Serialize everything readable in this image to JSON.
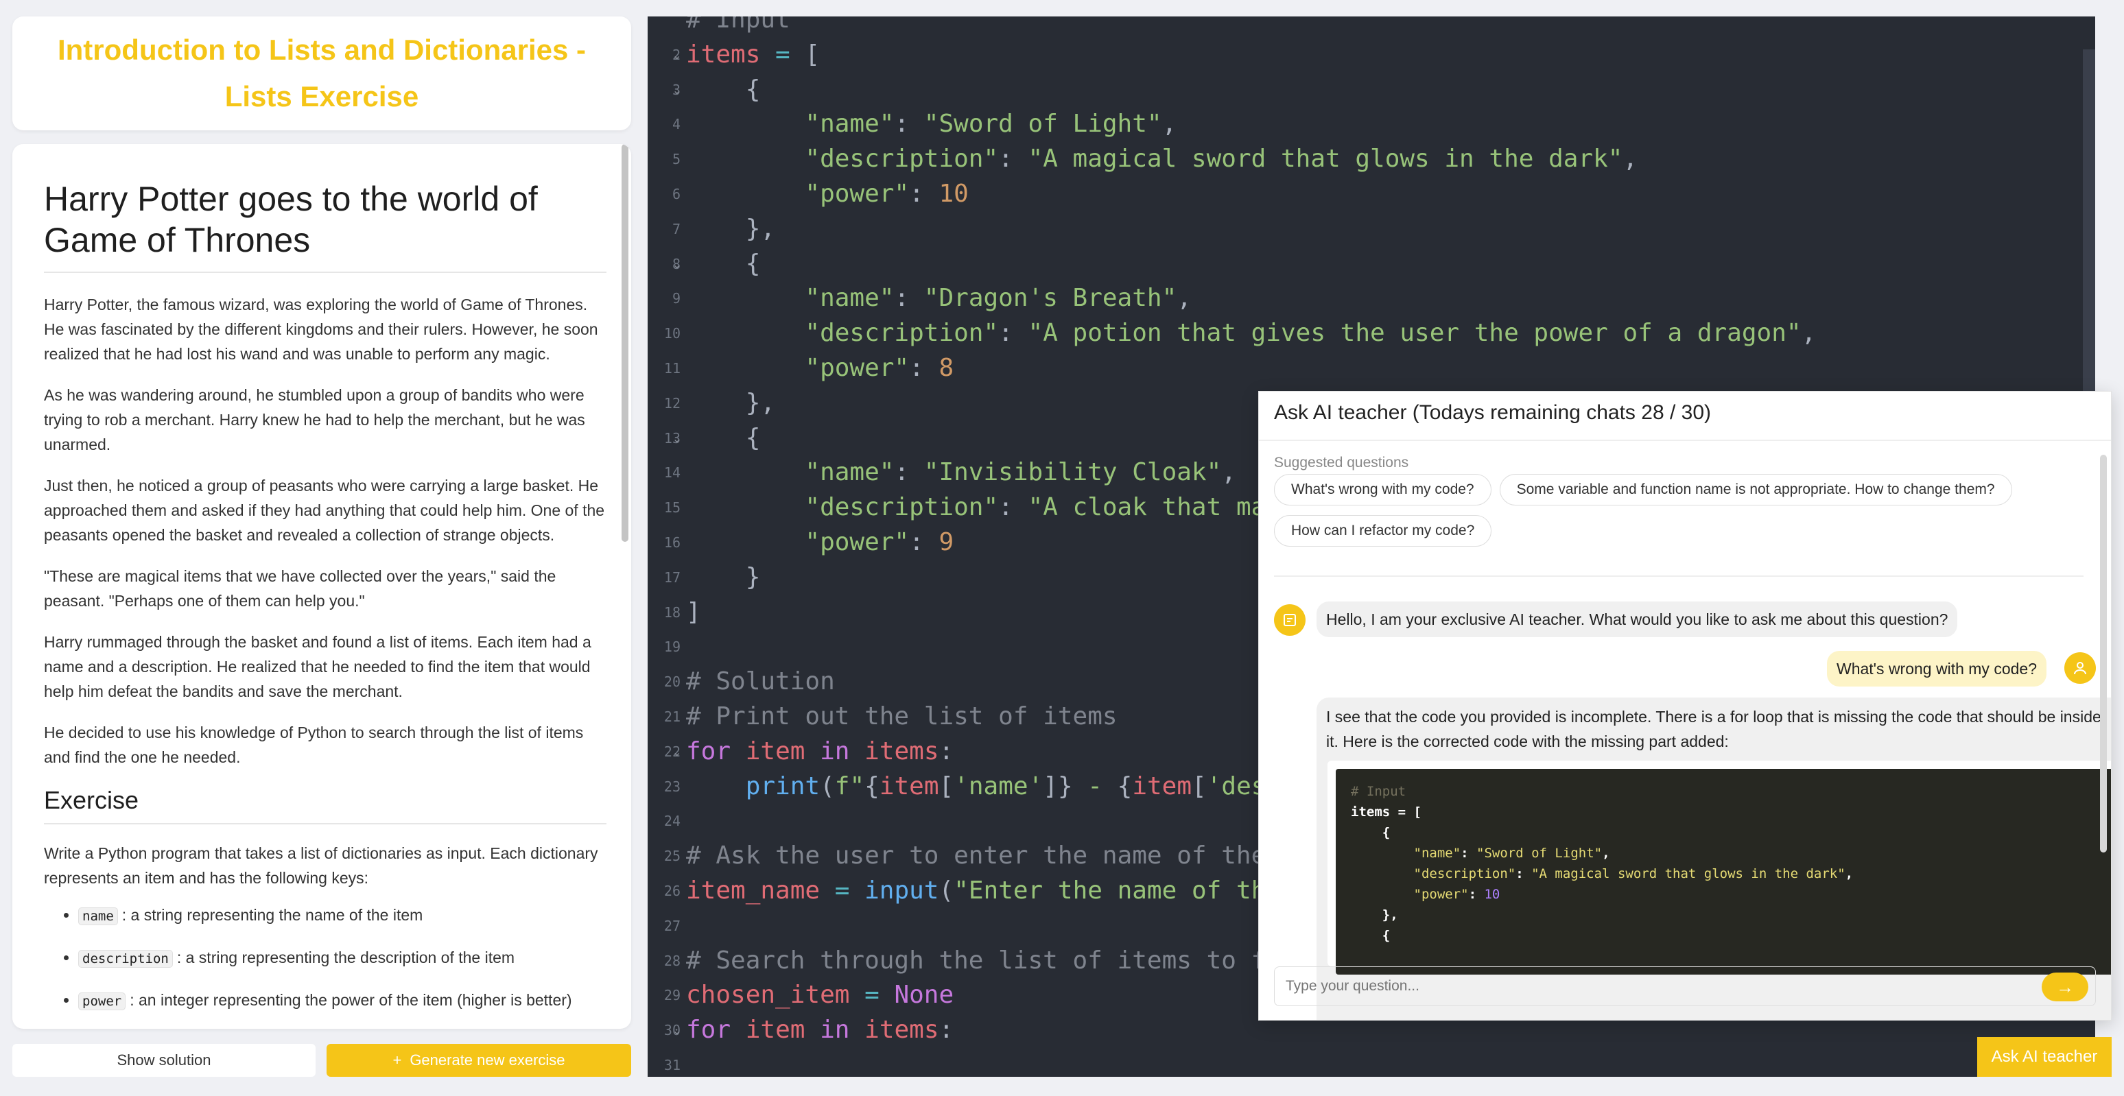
{
  "exercise_title": "Introduction to Lists and Dictionaries - Lists Exercise",
  "story": {
    "heading": "Harry Potter goes to the world of Game of Thrones",
    "paragraphs": [
      "Harry Potter, the famous wizard, was exploring the world of Game of Thrones. He was fascinated by the different kingdoms and their rulers. However, he soon realized that he had lost his wand and was unable to perform any magic.",
      "As he was wandering around, he stumbled upon a group of bandits who were trying to rob a merchant. Harry knew he had to help the merchant, but he was unarmed.",
      "Just then, he noticed a group of peasants who were carrying a large basket. He approached them and asked if they had anything that could help him. One of the peasants opened the basket and revealed a collection of strange objects.",
      "\"These are magical items that we have collected over the years,\" said the peasant. \"Perhaps one of them can help you.\"",
      "Harry rummaged through the basket and found a list of items. Each item had a name and a description. He realized that he needed to find the item that would help him defeat the bandits and save the merchant.",
      "He decided to use his knowledge of Python to search through the list of items and find the one he needed."
    ],
    "exercise_heading": "Exercise",
    "exercise_text": "Write a Python program that takes a list of dictionaries as input. Each dictionary represents an item and has the following keys:",
    "keys": [
      {
        "key": "name",
        "desc": ": a string representing the name of the item"
      },
      {
        "key": "description",
        "desc": ": a string representing the description of the item"
      },
      {
        "key": "power",
        "desc": ": an integer representing the power of the item (higher is better)"
      }
    ]
  },
  "buttons": {
    "show_solution": "Show solution",
    "generate": "Generate new exercise",
    "ask_ai": "Ask AI teacher"
  },
  "editor": {
    "lines": [
      {
        "n": "",
        "fold": false,
        "tokens": [
          [
            "cm",
            "# Input"
          ]
        ]
      },
      {
        "n": "2",
        "fold": true,
        "tokens": [
          [
            "var",
            "items"
          ],
          [
            "op",
            " = "
          ],
          [
            "p",
            "["
          ]
        ]
      },
      {
        "n": "3",
        "fold": true,
        "tokens": [
          [
            "p",
            "    {"
          ]
        ]
      },
      {
        "n": "4",
        "fold": false,
        "tokens": [
          [
            "p",
            "        "
          ],
          [
            "str",
            "\"name\""
          ],
          [
            "p",
            ": "
          ],
          [
            "str",
            "\"Sword of Light\""
          ],
          [
            "p",
            ","
          ]
        ]
      },
      {
        "n": "5",
        "fold": false,
        "tokens": [
          [
            "p",
            "        "
          ],
          [
            "str",
            "\"description\""
          ],
          [
            "p",
            ": "
          ],
          [
            "str",
            "\"A magical sword that glows in the dark\""
          ],
          [
            "p",
            ","
          ]
        ]
      },
      {
        "n": "6",
        "fold": false,
        "tokens": [
          [
            "p",
            "        "
          ],
          [
            "str",
            "\"power\""
          ],
          [
            "p",
            ": "
          ],
          [
            "num",
            "10"
          ]
        ]
      },
      {
        "n": "7",
        "fold": false,
        "tokens": [
          [
            "p",
            "    },"
          ]
        ]
      },
      {
        "n": "8",
        "fold": true,
        "tokens": [
          [
            "p",
            "    {"
          ]
        ]
      },
      {
        "n": "9",
        "fold": false,
        "tokens": [
          [
            "p",
            "        "
          ],
          [
            "str",
            "\"name\""
          ],
          [
            "p",
            ": "
          ],
          [
            "str",
            "\"Dragon's Breath\""
          ],
          [
            "p",
            ","
          ]
        ]
      },
      {
        "n": "10",
        "fold": false,
        "tokens": [
          [
            "p",
            "        "
          ],
          [
            "str",
            "\"description\""
          ],
          [
            "p",
            ": "
          ],
          [
            "str",
            "\"A potion that gives the user the power of a dragon\""
          ],
          [
            "p",
            ","
          ]
        ]
      },
      {
        "n": "11",
        "fold": false,
        "tokens": [
          [
            "p",
            "        "
          ],
          [
            "str",
            "\"power\""
          ],
          [
            "p",
            ": "
          ],
          [
            "num",
            "8"
          ]
        ]
      },
      {
        "n": "12",
        "fold": false,
        "tokens": [
          [
            "p",
            "    },"
          ]
        ]
      },
      {
        "n": "13",
        "fold": true,
        "tokens": [
          [
            "p",
            "    {"
          ]
        ]
      },
      {
        "n": "14",
        "fold": false,
        "tokens": [
          [
            "p",
            "        "
          ],
          [
            "str",
            "\"name\""
          ],
          [
            "p",
            ": "
          ],
          [
            "str",
            "\"Invisibility Cloak\""
          ],
          [
            "p",
            ","
          ]
        ]
      },
      {
        "n": "15",
        "fold": false,
        "tokens": [
          [
            "p",
            "        "
          ],
          [
            "str",
            "\"description\""
          ],
          [
            "p",
            ": "
          ],
          [
            "str",
            "\"A cloak that mak"
          ]
        ]
      },
      {
        "n": "16",
        "fold": false,
        "tokens": [
          [
            "p",
            "        "
          ],
          [
            "str",
            "\"power\""
          ],
          [
            "p",
            ": "
          ],
          [
            "num",
            "9"
          ]
        ]
      },
      {
        "n": "17",
        "fold": false,
        "tokens": [
          [
            "p",
            "    }"
          ]
        ]
      },
      {
        "n": "18",
        "fold": false,
        "tokens": [
          [
            "p",
            "]"
          ]
        ]
      },
      {
        "n": "19",
        "fold": false,
        "tokens": []
      },
      {
        "n": "20",
        "fold": false,
        "tokens": [
          [
            "cm",
            "# Solution"
          ]
        ]
      },
      {
        "n": "21",
        "fold": false,
        "tokens": [
          [
            "cm",
            "# Print out the list of items"
          ]
        ]
      },
      {
        "n": "22",
        "fold": true,
        "tokens": [
          [
            "kw",
            "for"
          ],
          [
            "p",
            " "
          ],
          [
            "var",
            "item"
          ],
          [
            "p",
            " "
          ],
          [
            "kw",
            "in"
          ],
          [
            "p",
            " "
          ],
          [
            "var",
            "items"
          ],
          [
            "p",
            ":"
          ]
        ]
      },
      {
        "n": "23",
        "fold": false,
        "tokens": [
          [
            "p",
            "    "
          ],
          [
            "fn",
            "print"
          ],
          [
            "p",
            "("
          ],
          [
            "str",
            "f\""
          ],
          [
            "p",
            "{"
          ],
          [
            "var",
            "item"
          ],
          [
            "p",
            "["
          ],
          [
            "str",
            "'name'"
          ],
          [
            "p",
            "]}"
          ],
          [
            "str",
            " - "
          ],
          [
            "p",
            "{"
          ],
          [
            "var",
            "item"
          ],
          [
            "p",
            "["
          ],
          [
            "str",
            "'desc"
          ]
        ]
      },
      {
        "n": "24",
        "fold": false,
        "tokens": []
      },
      {
        "n": "25",
        "fold": false,
        "tokens": [
          [
            "cm",
            "# Ask the user to enter the name of the"
          ]
        ]
      },
      {
        "n": "26",
        "fold": false,
        "tokens": [
          [
            "var",
            "item_name"
          ],
          [
            "op",
            " = "
          ],
          [
            "fn",
            "input"
          ],
          [
            "p",
            "("
          ],
          [
            "str",
            "\"Enter the name of the"
          ]
        ]
      },
      {
        "n": "27",
        "fold": false,
        "tokens": []
      },
      {
        "n": "28",
        "fold": false,
        "tokens": [
          [
            "cm",
            "# Search through the list of items to fi"
          ]
        ]
      },
      {
        "n": "29",
        "fold": false,
        "tokens": [
          [
            "var",
            "chosen_item"
          ],
          [
            "op",
            " = "
          ],
          [
            "kw",
            "None"
          ]
        ]
      },
      {
        "n": "30",
        "fold": true,
        "tokens": [
          [
            "kw",
            "for"
          ],
          [
            "p",
            " "
          ],
          [
            "var",
            "item"
          ],
          [
            "p",
            " "
          ],
          [
            "kw",
            "in"
          ],
          [
            "p",
            " "
          ],
          [
            "var",
            "items"
          ],
          [
            "p",
            ":"
          ]
        ]
      },
      {
        "n": "31",
        "fold": false,
        "tokens": []
      }
    ]
  },
  "chat": {
    "title": "Ask AI teacher (Todays remaining chats 28 / 30)",
    "suggested_label": "Suggested questions",
    "suggestions": [
      "What's wrong with my code?",
      "Some variable and function name is not appropriate. How to change them?",
      "How can I refactor my code?"
    ],
    "greeting": "Hello, I am your exclusive AI teacher. What would you like to ask me about this question?",
    "user_message": "What's wrong with my code?",
    "reply": "I see that the code you provided is incomplete. There is a for loop that is missing the code that should be inside it. Here is the corrected code with the missing part added:",
    "reply_code": [
      [
        [
          "cm",
          "# Input"
        ]
      ],
      [
        [
          "b",
          "items"
        ],
        [
          "b",
          " = ["
        ]
      ],
      [
        [
          "b",
          "    {"
        ]
      ],
      [
        [
          "str",
          "        \"name\""
        ],
        [
          "b",
          ": "
        ],
        [
          "str",
          "\"Sword of Light\""
        ],
        [
          "b",
          ","
        ]
      ],
      [
        [
          "str",
          "        \"description\""
        ],
        [
          "b",
          ": "
        ],
        [
          "str",
          "\"A magical sword that glows in the dark\""
        ],
        [
          "b",
          ","
        ]
      ],
      [
        [
          "str",
          "        \"power\""
        ],
        [
          "b",
          ": "
        ],
        [
          "num",
          "10"
        ]
      ],
      [
        [
          "b",
          "    },"
        ]
      ],
      [
        [
          "b",
          "    {"
        ]
      ]
    ],
    "input_placeholder": "Type your question..."
  },
  "colors": {
    "accent": "#f5c518",
    "editor_bg": "#282c34"
  }
}
